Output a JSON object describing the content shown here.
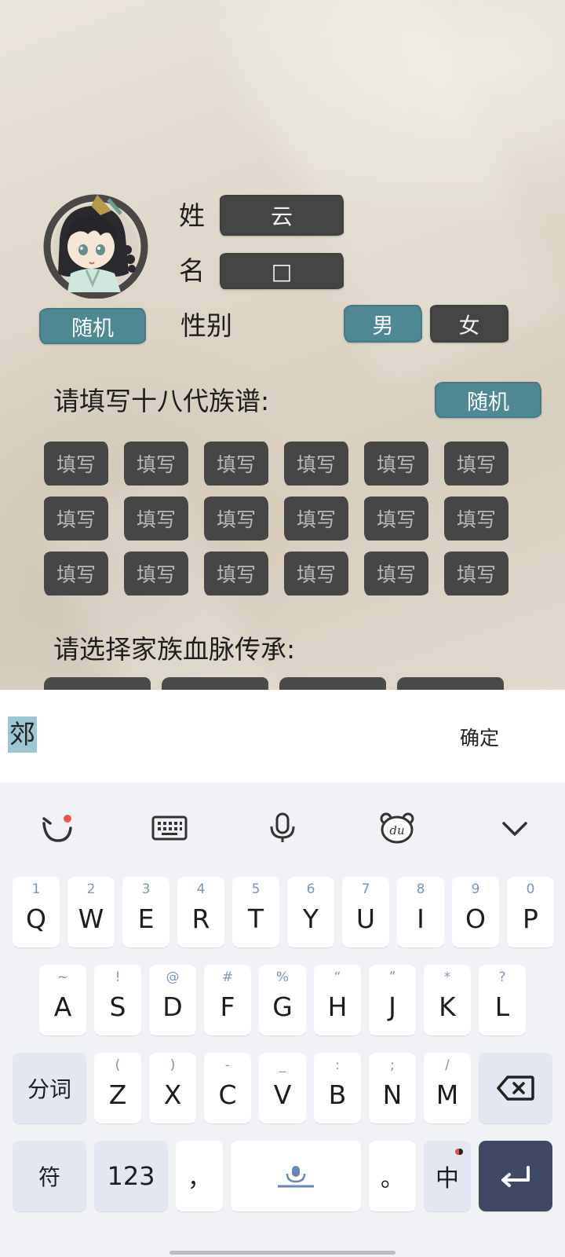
{
  "game": {
    "surname_label": "姓",
    "surname_value": "云",
    "given_label": "名",
    "given_value": "□",
    "gender_label": "性别",
    "gender_options": [
      "男",
      "女"
    ],
    "gender_selected": "男",
    "random_avatar_label": "随机",
    "genealogy_prompt": "请填写十八代族谱:",
    "genealogy_random_label": "随机",
    "genealogy_slots": [
      "填写",
      "填写",
      "填写",
      "填写",
      "填写",
      "填写",
      "填写",
      "填写",
      "填写",
      "填写",
      "填写",
      "填写",
      "填写",
      "填写",
      "填写",
      "填写",
      "填写",
      "填写"
    ],
    "bloodline_prompt": "请选择家族血脉传承:"
  },
  "ime": {
    "candidate": "郊",
    "confirm_label": "确定",
    "toolbar_icons": [
      "emoji-icon",
      "keyboard-icon",
      "microphone-icon",
      "du-bear-icon",
      "collapse-icon"
    ],
    "row1": [
      {
        "hint": "1",
        "key": "Q"
      },
      {
        "hint": "2",
        "key": "W"
      },
      {
        "hint": "3",
        "key": "E"
      },
      {
        "hint": "4",
        "key": "R"
      },
      {
        "hint": "5",
        "key": "T"
      },
      {
        "hint": "6",
        "key": "Y"
      },
      {
        "hint": "7",
        "key": "U"
      },
      {
        "hint": "8",
        "key": "I"
      },
      {
        "hint": "9",
        "key": "O"
      },
      {
        "hint": "0",
        "key": "P"
      }
    ],
    "row2": [
      {
        "hint": "~",
        "key": "A"
      },
      {
        "hint": "!",
        "key": "S"
      },
      {
        "hint": "@",
        "key": "D"
      },
      {
        "hint": "#",
        "key": "F"
      },
      {
        "hint": "%",
        "key": "G"
      },
      {
        "hint": "“",
        "key": "H"
      },
      {
        "hint": "”",
        "key": "J"
      },
      {
        "hint": "*",
        "key": "K"
      },
      {
        "hint": "?",
        "key": "L"
      }
    ],
    "row3": [
      {
        "hint": "(",
        "key": "Z"
      },
      {
        "hint": ")",
        "key": "X"
      },
      {
        "hint": "-",
        "key": "C"
      },
      {
        "hint": "_",
        "key": "V"
      },
      {
        "hint": ":",
        "key": "B"
      },
      {
        "hint": ";",
        "key": "N"
      },
      {
        "hint": "/",
        "key": "M"
      }
    ],
    "segment_label": "分词",
    "symbol_label": "符",
    "numbers_label": "123",
    "comma_label": "，",
    "period_label": "。",
    "lang_label": "中",
    "colors": {
      "enter": "#3e4a63",
      "accent": "#4f8793"
    }
  }
}
